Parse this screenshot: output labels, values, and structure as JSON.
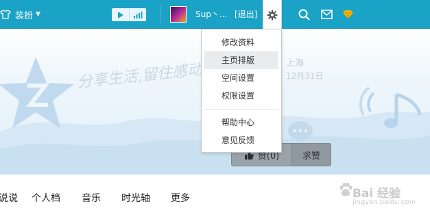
{
  "topbar": {
    "dressup_label": "装扮",
    "username": "Sup丶...",
    "logout_label": "[退出]",
    "icons": {
      "shirt": "shirt-icon",
      "caret": "caret-down-icon",
      "play": "play-icon",
      "music_bars": "music-bars-icon",
      "gear": "gear-icon",
      "search": "search-icon",
      "mail": "mail-icon",
      "diamond": "diamond-icon"
    },
    "colors": {
      "bar": "#1aa3c6",
      "diamond": "#f5b800"
    }
  },
  "banner": {
    "slogan": "分享生活,留住感动",
    "location": "上海",
    "date": "12月31日",
    "like_label": "赞(0)",
    "gift_label": "求赞"
  },
  "settings_menu": {
    "items": [
      {
        "label": "修改资料",
        "active": false
      },
      {
        "label": "主页排版",
        "active": true
      },
      {
        "label": "空间设置",
        "active": false
      },
      {
        "label": "权限设置",
        "active": false
      }
    ],
    "items2": [
      {
        "label": "帮助中心"
      },
      {
        "label": "意见反馈"
      }
    ]
  },
  "nav": {
    "items": [
      {
        "label": "说说"
      },
      {
        "label": "个人档"
      },
      {
        "label": "音乐"
      },
      {
        "label": "时光轴"
      },
      {
        "label": "更多"
      }
    ]
  },
  "watermark": {
    "brand": "Bai 经验",
    "url": "jingyan.baidu.com"
  }
}
